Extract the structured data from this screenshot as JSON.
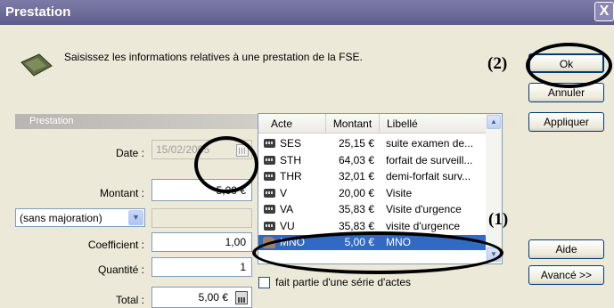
{
  "window": {
    "title": "Prestation",
    "close_glyph": "X"
  },
  "intro": {
    "text": "Saisissez les informations relatives à une prestation de la FSE."
  },
  "group": {
    "title": "Prestation"
  },
  "form": {
    "date_label": "Date :",
    "date_value": "15/02/2005",
    "montant_label": "Montant :",
    "montant_value": "5,00 €",
    "majoration_value": "(sans majoration)",
    "coefficient_label": "Coefficient :",
    "coefficient_value": "1,00",
    "quantite_label": "Quantité :",
    "quantite_value": "1",
    "total_label": "Total :",
    "total_value": "5,00 €"
  },
  "list": {
    "columns": [
      "Acte",
      "Montant",
      "Libellé"
    ],
    "rows": [
      {
        "acte": "SES",
        "montant": "25,15 €",
        "libelle": "suite examen de..."
      },
      {
        "acte": "STH",
        "montant": "64,03 €",
        "libelle": "forfait de surveill..."
      },
      {
        "acte": "THR",
        "montant": "32,01 €",
        "libelle": "demi-forfait surv..."
      },
      {
        "acte": "V",
        "montant": "20,00 €",
        "libelle": "Visite"
      },
      {
        "acte": "VA",
        "montant": "35,83 €",
        "libelle": "Visite d'urgence"
      },
      {
        "acte": "VU",
        "montant": "35,83 €",
        "libelle": "visite d'urgence"
      },
      {
        "acte": "MNO",
        "montant": "5,00 €",
        "libelle": "MNO"
      }
    ],
    "selected_index": 6
  },
  "serie_checkbox": {
    "label": "fait partie d'une série d'actes",
    "checked": false
  },
  "buttons": {
    "ok": "Ok",
    "annuler": "Annuler",
    "appliquer": "Appliquer",
    "aide": "Aide",
    "avance": "Avancé >>"
  },
  "annotations": {
    "label_1": "(1)",
    "label_2": "(2)"
  },
  "icons": {
    "intro": "card-reader-icon",
    "date_picker": "calendar-icon",
    "total_calc": "calculator-icon",
    "row_code": "code-chip-icon",
    "row_selected": "thumb-icon"
  }
}
